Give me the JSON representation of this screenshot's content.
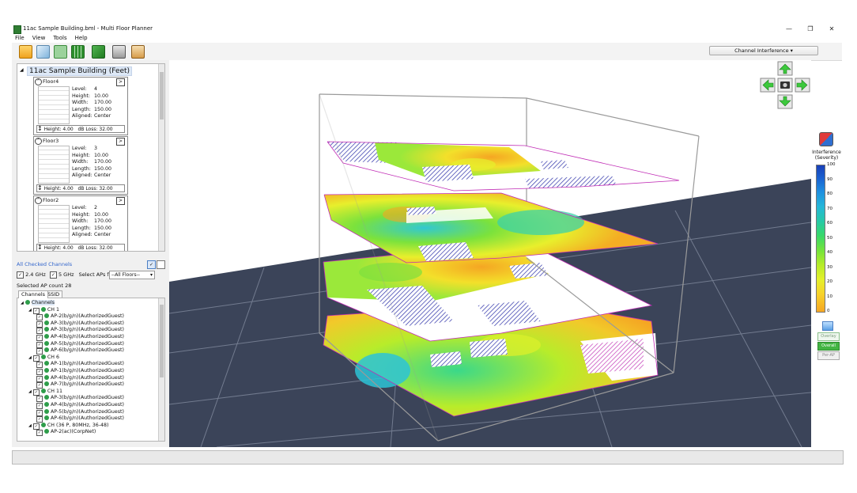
{
  "window": {
    "title": "11ac Sample Building.bml - Multi Floor Planner",
    "controls": [
      "—",
      "❐",
      "✕"
    ]
  },
  "menu": [
    "File",
    "View",
    "Tools",
    "Help"
  ],
  "toolbar": {
    "icons": [
      "open-folder-icon",
      "cube-3d-icon",
      "square-view-icon",
      "grid-view-icon",
      "export-icon",
      "print-icon",
      "clipboard-icon"
    ],
    "view_mode": "Channel Interference"
  },
  "building": {
    "title": "11ac Sample Building (Feet)",
    "floors": [
      {
        "name": "Floor4",
        "level": "4",
        "height": "10.00",
        "width": "170.00",
        "length": "150.00",
        "aligned": "Center",
        "floor_height": "Height: 4.00",
        "db_loss": "dB Loss: 32.00"
      },
      {
        "name": "Floor3",
        "level": "3",
        "height": "10.00",
        "width": "170.00",
        "length": "150.00",
        "aligned": "Center",
        "floor_height": "Height: 4.00",
        "db_loss": "dB Loss: 32.00"
      },
      {
        "name": "Floor2",
        "level": "2",
        "height": "10.00",
        "width": "170.00",
        "length": "150.00",
        "aligned": "Center",
        "floor_height": "Height: 4.00",
        "db_loss": "dB Loss: 32.00"
      }
    ],
    "prop_labels": {
      "level": "Level:",
      "height": "Height:",
      "width": "Width:",
      "length": "Length:",
      "aligned": "Aligned:"
    }
  },
  "channels_panel": {
    "header": "All Checked Channels",
    "band_24": "2.4 GHz",
    "band_5": "5 GHz",
    "select_label": "Select APs from:",
    "select_value": "--All Floors--",
    "ap_count": "Selected AP count 28",
    "tabs": [
      "Channels",
      "SSID"
    ],
    "tree": [
      {
        "level": 0,
        "text": "Channels",
        "root": true
      },
      {
        "level": 1,
        "text": "CH 1"
      },
      {
        "level": 2,
        "text": "AP-2(b/g/n)(AuthorizedGuest)"
      },
      {
        "level": 2,
        "text": "AP-3(b/g/n)(AuthorizedGuest)"
      },
      {
        "level": 2,
        "text": "AP-3(b/g/n)(AuthorizedGuest)"
      },
      {
        "level": 2,
        "text": "AP-4(b/g/n)(AuthorizedGuest)"
      },
      {
        "level": 2,
        "text": "AP-5(b/g/n)(AuthorizedGuest)"
      },
      {
        "level": 2,
        "text": "AP-6(b/g/n)(AuthorizedGuest)"
      },
      {
        "level": 1,
        "text": "CH 6"
      },
      {
        "level": 2,
        "text": "AP-1(b/g/n)(AuthorizedGuest)"
      },
      {
        "level": 2,
        "text": "AP-1(b/g/n)(AuthorizedGuest)"
      },
      {
        "level": 2,
        "text": "AP-4(b/g/n)(AuthorizedGuest)"
      },
      {
        "level": 2,
        "text": "AP-7(b/g/n)(AuthorizedGuest)"
      },
      {
        "level": 1,
        "text": "CH 11"
      },
      {
        "level": 2,
        "text": "AP-3(b/g/n)(AuthorizedGuest)"
      },
      {
        "level": 2,
        "text": "AP-4(b/g/n)(AuthorizedGuest)"
      },
      {
        "level": 2,
        "text": "AP-5(b/g/n)(AuthorizedGuest)"
      },
      {
        "level": 2,
        "text": "AP-6(b/g/n)(AuthorizedGuest)"
      },
      {
        "level": 1,
        "text": "CH (36 P, 80MHz, 36-48)"
      },
      {
        "level": 2,
        "text": "AP-2(ac)(CorpNet)"
      }
    ]
  },
  "legend": {
    "title": "Interference (Severity)",
    "ticks": [
      "100",
      "90",
      "80",
      "70",
      "60",
      "50",
      "40",
      "30",
      "20",
      "10",
      "0"
    ],
    "buttons": [
      "Overlay",
      "Overall",
      "Per-AP"
    ]
  },
  "colors": {
    "ground": "#3b4459",
    "grid": "#8a93a6",
    "nav_arrow": "#3cc93c",
    "scale": [
      "#f5a623",
      "#f7d22b",
      "#e4f02c",
      "#b6ec2a",
      "#74e33c",
      "#38d86a",
      "#27c9a8",
      "#25b6d9",
      "#1f8fe0",
      "#1b63d1",
      "#1940b8"
    ]
  }
}
